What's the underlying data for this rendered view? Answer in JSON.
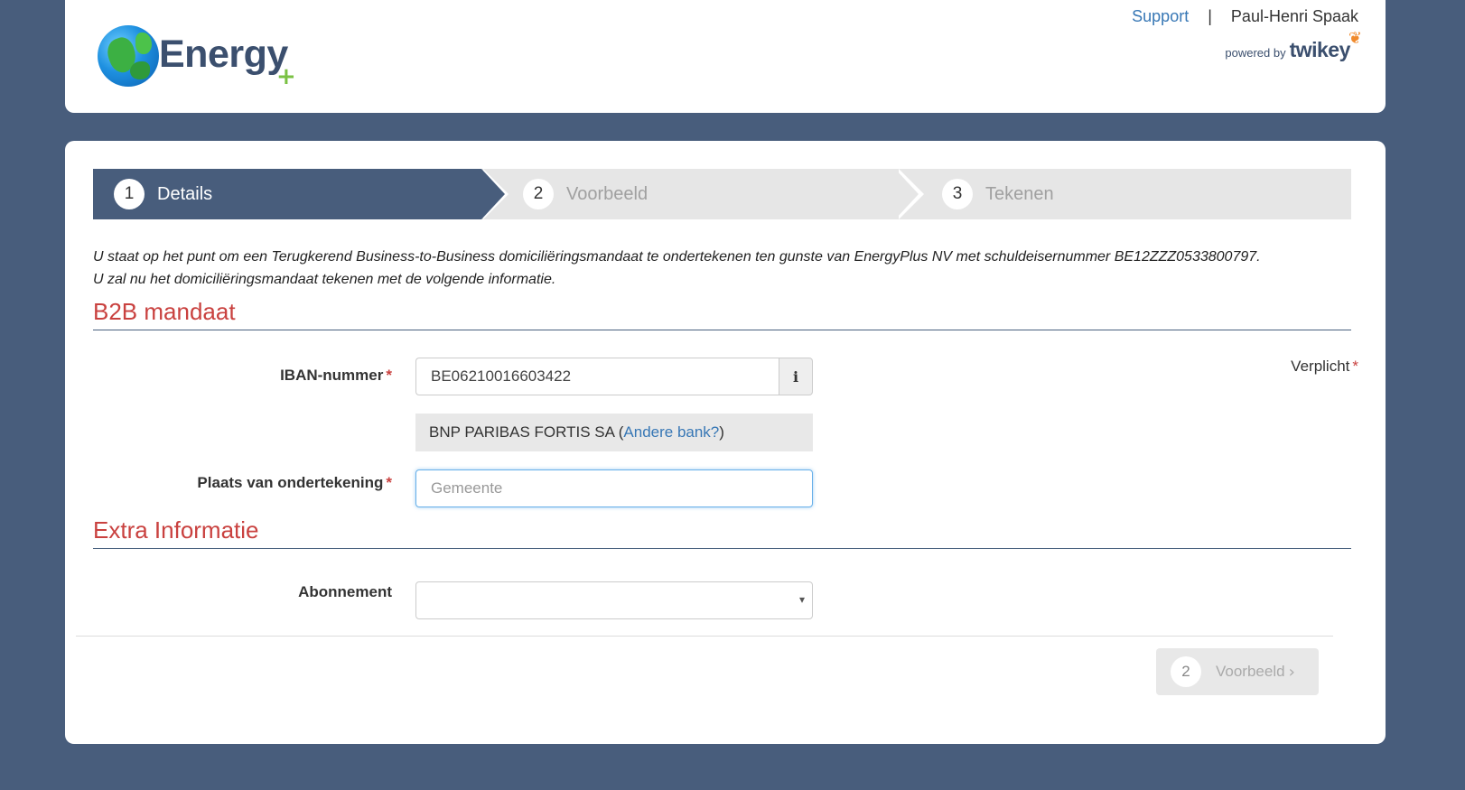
{
  "header": {
    "logo_text": "Energy",
    "logo_plus": "+",
    "support_link": "Support",
    "separator": "|",
    "user_name": "Paul-Henri Spaak",
    "powered_by": "powered by",
    "powered_brand": "twikey"
  },
  "wizard": {
    "steps": [
      {
        "number": "1",
        "label": "Details",
        "active": true
      },
      {
        "number": "2",
        "label": "Voorbeeld",
        "active": false
      },
      {
        "number": "3",
        "label": "Tekenen",
        "active": false
      }
    ]
  },
  "intro": "U staat op het punt om een Terugkerend Business-to-Business domiciliëringsmandaat te ondertekenen ten gunste van EnergyPlus NV met schuldeisernummer BE12ZZZ0533800797. U zal nu het domiciliëringsmandaat tekenen met de volgende informatie.",
  "sections": {
    "mandate_title": "B2B mandaat",
    "extra_title": "Extra Informatie"
  },
  "form": {
    "required_note": "Verplicht",
    "required_marker": "*",
    "iban_label": "IBAN-nummer",
    "iban_value": "BE06210016603422",
    "info_icon": "i",
    "bank_name": "BNP PARIBAS FORTIS SA (",
    "bank_link": "Andere bank?",
    "bank_close": ")",
    "place_label": "Plaats van ondertekening",
    "place_placeholder": "Gemeente",
    "place_value": "",
    "subscription_label": "Abonnement",
    "subscription_value": "",
    "select_caret": "▾"
  },
  "footer": {
    "next_number": "2",
    "next_label": "Voorbeeld",
    "next_chevron": "›"
  },
  "colors": {
    "background": "#485d7c",
    "accent_red": "#c9413f",
    "link_blue": "#3777b5",
    "wizard_active": "#485d7c",
    "wizard_inactive": "#e6e6e6"
  }
}
